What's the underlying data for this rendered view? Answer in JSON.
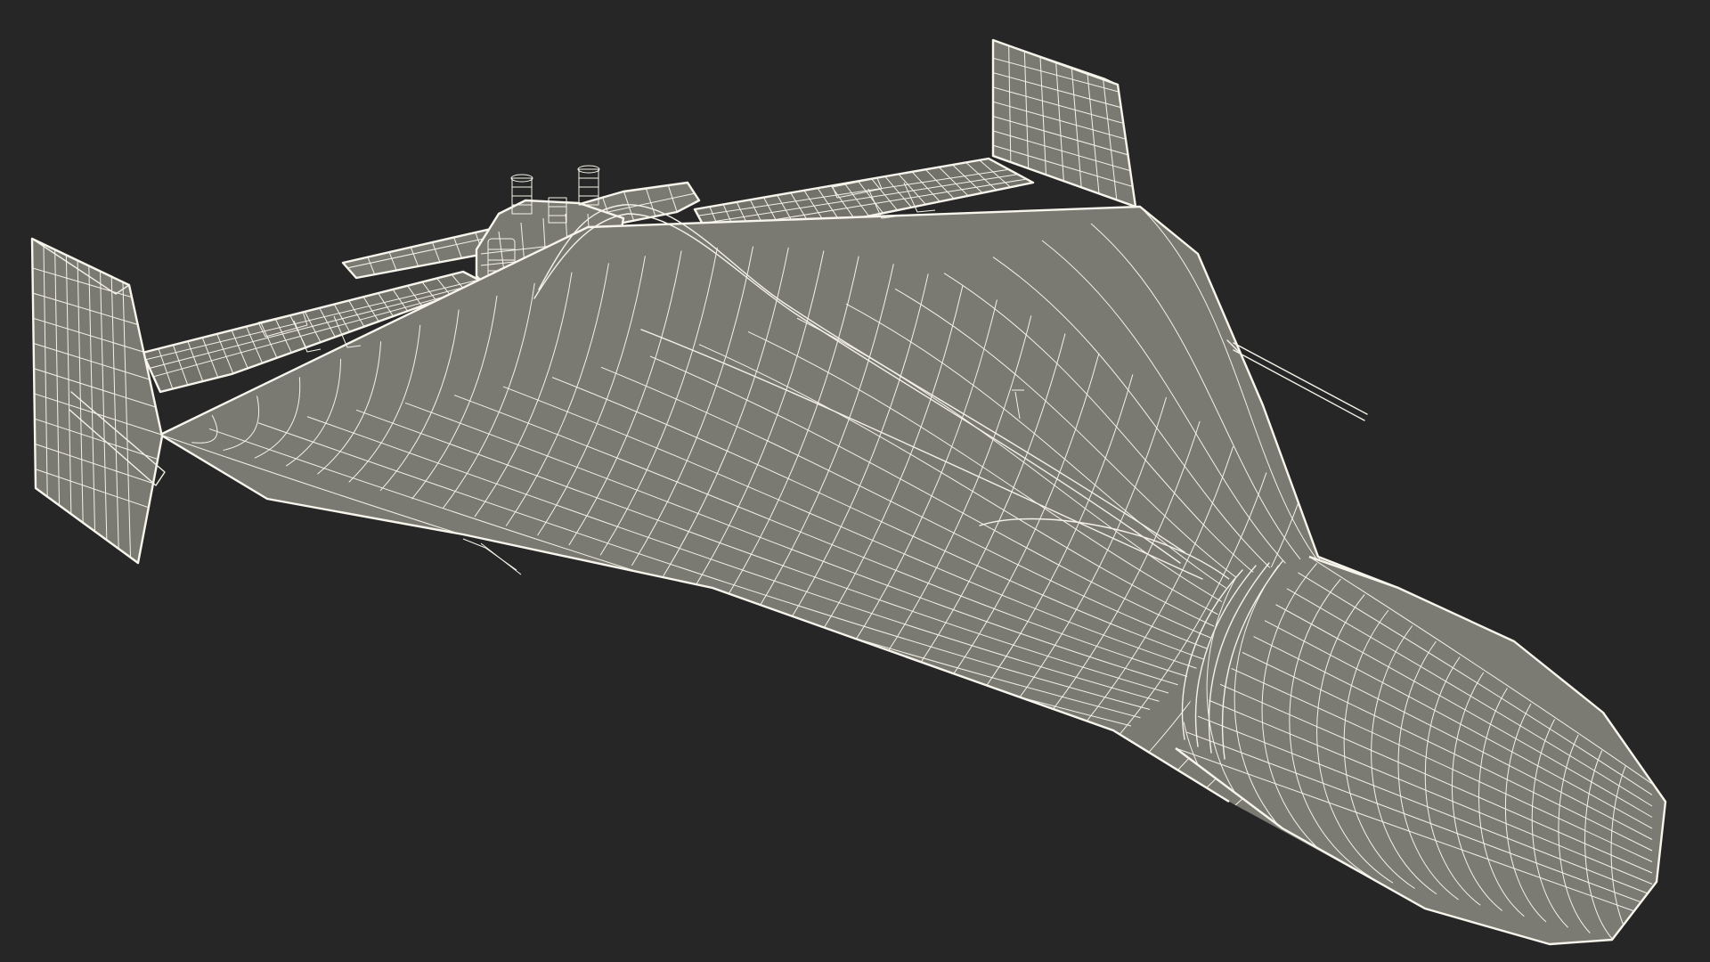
{
  "scene": {
    "background": "#262626",
    "surface_color": "#7b7a72",
    "surface_dark": "#6f6e67",
    "wire_color": "#f4f2e8",
    "subject": "drone-wireframe"
  }
}
